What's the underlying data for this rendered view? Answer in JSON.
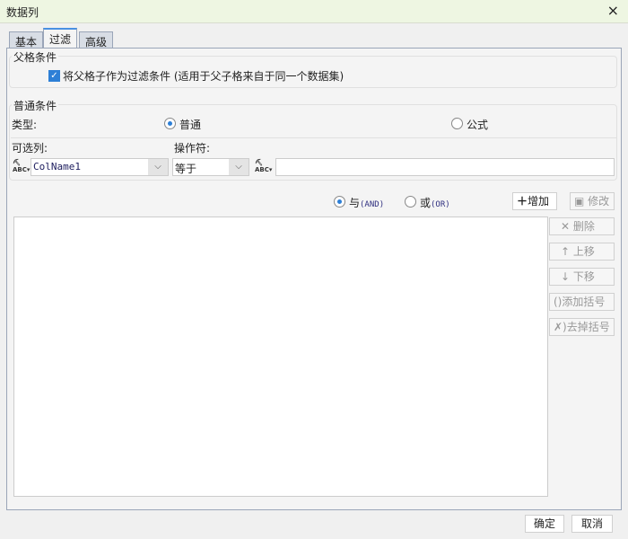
{
  "window": {
    "title": "数据列",
    "close_icon": "×"
  },
  "tabs": [
    {
      "label": "基本"
    },
    {
      "label": "过滤",
      "active": true
    },
    {
      "label": "高级"
    }
  ],
  "parent_condition": {
    "legend": "父格条件",
    "checkbox_label": "将父格子作为过滤条件 (适用于父子格来自于同一个数据集)",
    "checked": true
  },
  "normal_condition": {
    "legend": "普通条件",
    "type_label": "类型:",
    "type_options": [
      {
        "label": "普通",
        "selected": true
      },
      {
        "label": "公式",
        "selected": false
      }
    ],
    "column_label": "可选列:",
    "operator_label": "操作符:",
    "column_value": "ColName1",
    "operator_value": "等于",
    "value_input": ""
  },
  "logic": [
    {
      "label": "与",
      "code": "(AND)",
      "selected": true
    },
    {
      "label": "或",
      "code": "(OR)",
      "selected": false
    }
  ],
  "buttons": {
    "add": "增加",
    "modify": "修改",
    "delete": "删除",
    "move_up": "上移",
    "move_down": "下移",
    "add_bracket": "添加括号",
    "remove_bracket": "去掉括号"
  },
  "footer": {
    "ok": "确定",
    "cancel": "取消"
  }
}
